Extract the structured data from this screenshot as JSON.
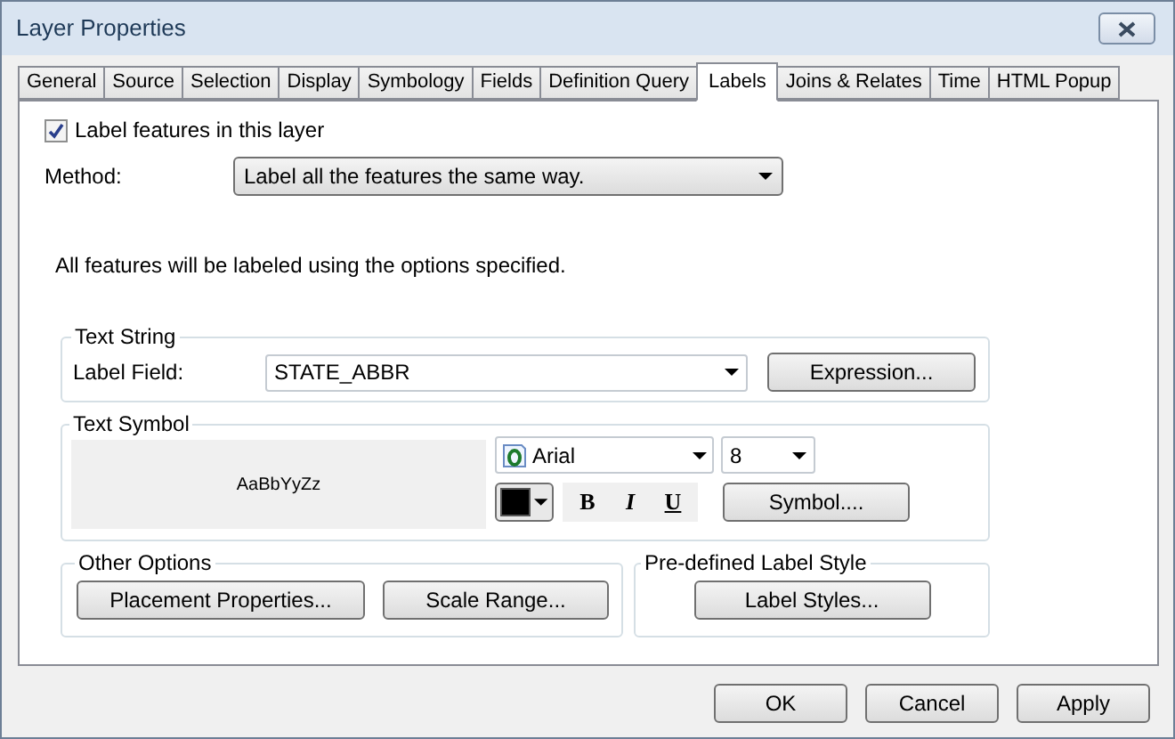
{
  "window": {
    "title": "Layer Properties"
  },
  "tabs": [
    {
      "label": "General",
      "selected": false
    },
    {
      "label": "Source",
      "selected": false
    },
    {
      "label": "Selection",
      "selected": false
    },
    {
      "label": "Display",
      "selected": false
    },
    {
      "label": "Symbology",
      "selected": false
    },
    {
      "label": "Fields",
      "selected": false
    },
    {
      "label": "Definition Query",
      "selected": false
    },
    {
      "label": "Labels",
      "selected": true
    },
    {
      "label": "Joins & Relates",
      "selected": false
    },
    {
      "label": "Time",
      "selected": false
    },
    {
      "label": "HTML Popup",
      "selected": false
    }
  ],
  "label_features": {
    "label": "Label features in this layer",
    "checked": true
  },
  "method": {
    "label": "Method:",
    "value": "Label all the features the same way."
  },
  "description": "All features will be labeled using the options specified.",
  "text_string": {
    "title": "Text String",
    "field_label": "Label Field:",
    "field_value": "STATE_ABBR",
    "button": "Expression..."
  },
  "text_symbol": {
    "title": "Text Symbol",
    "preview": "AaBbYyZz",
    "font": "Arial",
    "size": "8",
    "bold": "B",
    "italic": "I",
    "underline": "U",
    "button": "Symbol...."
  },
  "other_options": {
    "title": "Other Options",
    "buttons": [
      "Placement Properties...",
      "Scale Range..."
    ]
  },
  "predefined": {
    "title": "Pre-defined Label Style",
    "button": "Label Styles..."
  },
  "buttons": [
    "OK",
    "Cancel",
    "Apply"
  ]
}
